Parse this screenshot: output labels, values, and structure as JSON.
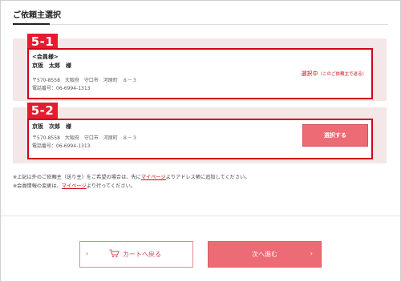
{
  "header": {
    "title": "ご依頼主選択"
  },
  "options": [
    {
      "step": "5-1",
      "member_tag": "<会員様>",
      "name": "京阪　太郎　様",
      "address": "〒570-8558　大阪府　守口市　河原町　８－３",
      "phone": "電話番号：06-6994-1313",
      "status": "選択中",
      "status_note": "（このご依頼主で送る）"
    },
    {
      "step": "5-2",
      "name": "京阪　次郎　様",
      "address": "〒570-8558　大阪府　守口市　河原町　８－３",
      "phone": "電話番号：06-6994-1313",
      "button_label": "選択する"
    }
  ],
  "notes": {
    "line1_pre": "※上記以外のご依頼主（送り主）をご希望の場合は、先に",
    "line1_link": "マイページ",
    "line1_post": "よりアドレス帳に追加してください。",
    "line2_pre": "※会員情報の変更は、",
    "line2_link": "マイページ",
    "line2_post": "より行ってください。"
  },
  "footer": {
    "back_label": "カートへ戻る",
    "next_label": "次へ進む"
  },
  "colors": {
    "accent_red": "#d40018",
    "badge_red": "#e51b2e",
    "button_pink": "#ec6b74",
    "card_bg": "#f4e7e8"
  },
  "icons": {
    "back_chevron": "chevron-left-icon",
    "cart": "cart-icon",
    "next_chevron": "chevron-right-icon"
  }
}
